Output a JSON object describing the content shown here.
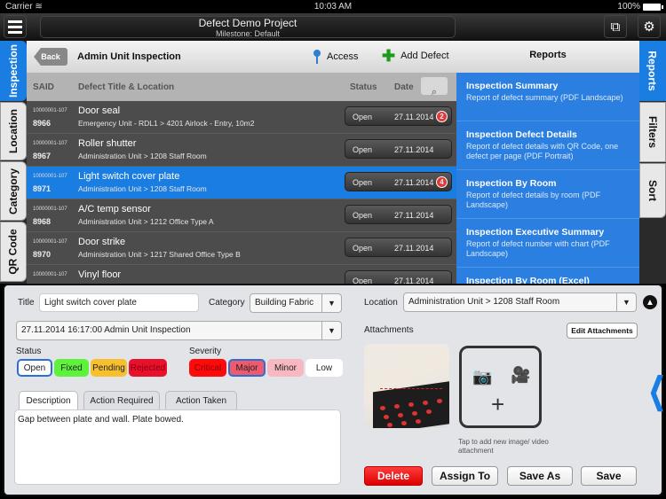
{
  "status_bar": {
    "carrier": "Carrier",
    "wifi_icon": "wifi-icon",
    "time": "10:03 AM",
    "battery": "100%"
  },
  "header": {
    "title": "Defect Demo Project",
    "subtitle": "Milestone: Default",
    "menu_icon": "menu-icon",
    "external_icon": "external-window-icon",
    "settings_icon": "gear-icon"
  },
  "left_tabs": [
    {
      "label": "Inspection",
      "active": true
    },
    {
      "label": "Location",
      "active": false
    },
    {
      "label": "Category",
      "active": false
    },
    {
      "label": "QR Code",
      "active": false
    }
  ],
  "toolbar": {
    "back_label": "Back",
    "title": "Admin Unit Inspection",
    "access_label": "Access",
    "add_defect_label": "Add Defect"
  },
  "columns": {
    "said": "SAID",
    "title": "Defect Title & Location",
    "status": "Status",
    "date": "Date"
  },
  "defects": [
    {
      "said_top": "10000001-107",
      "said": "8966",
      "title": "Door seal",
      "location": "Emergency Unit - RDL1 > 4201 Airlock - Entry, 10m2",
      "status": "Open",
      "date": "27.11.2014",
      "badge": "2",
      "selected": false
    },
    {
      "said_top": "10000001-107",
      "said": "8967",
      "title": "Roller shutter",
      "location": "Administration Unit > 1208 Staff Room",
      "status": "Open",
      "date": "27.11.2014",
      "badge": "",
      "selected": false
    },
    {
      "said_top": "10000001-107",
      "said": "8971",
      "title": "Light switch cover plate",
      "location": "Administration Unit > 1208 Staff Room",
      "status": "Open",
      "date": "27.11.2014",
      "badge": "4",
      "selected": true
    },
    {
      "said_top": "10000001-107",
      "said": "8968",
      "title": "A/C temp sensor",
      "location": "Administration Unit > 1212 Office Type A",
      "status": "Open",
      "date": "27.11.2014",
      "badge": "",
      "selected": false
    },
    {
      "said_top": "10000001-107",
      "said": "8970",
      "title": "Door strike",
      "location": "Administration Unit > 1217 Shared Office Type B",
      "status": "Open",
      "date": "27.11.2014",
      "badge": "",
      "selected": false
    },
    {
      "said_top": "10000001-107",
      "said": "",
      "title": "Vinyl floor",
      "location": "",
      "status": "Open",
      "date": "27.11.2014",
      "badge": "",
      "selected": false
    }
  ],
  "reports": {
    "header": "Reports",
    "items": [
      {
        "title": "Inspection Summary",
        "desc": "Report of defect summary (PDF Landscape)"
      },
      {
        "title": "Inspection Defect Details",
        "desc": "Report of defect details with QR Code, one defect per page (PDF Portrait)"
      },
      {
        "title": "Inspection By Room",
        "desc": "Report of defect details by room (PDF Landscape)"
      },
      {
        "title": "Inspection Executive Summary",
        "desc": "Report of defect number with chart (PDF Landscape)"
      },
      {
        "title": "Inspection By Room (Excel)",
        "desc": ""
      }
    ]
  },
  "right_tabs": [
    {
      "label": "Reports",
      "active": true
    },
    {
      "label": "Filters",
      "active": false
    },
    {
      "label": "Sort",
      "active": false
    }
  ],
  "detail": {
    "title_label": "Title",
    "title_value": "Light switch cover plate",
    "category_label": "Category",
    "category_value": "Building Fabric",
    "inspection_value": "27.11.2014 16:17:00 Admin Unit Inspection",
    "location_label": "Location",
    "location_value": "Administration Unit > 1208 Staff Room",
    "status_label": "Status",
    "status_options": [
      {
        "label": "Open",
        "color": "#ffffff",
        "selected": true
      },
      {
        "label": "Fixed",
        "color": "#5ef23a",
        "selected": false
      },
      {
        "label": "Pending",
        "color": "#f7c02e",
        "selected": false
      },
      {
        "label": "Rejected",
        "color": "#e8102a",
        "selected": false
      }
    ],
    "severity_label": "Severity",
    "severity_options": [
      {
        "label": "Critical",
        "color": "#ff0a0a",
        "selected": false
      },
      {
        "label": "Major",
        "color": "#f05a6e",
        "selected": true
      },
      {
        "label": "Minor",
        "color": "#f7b8c2",
        "selected": false
      },
      {
        "label": "Low",
        "color": "#ffffff",
        "selected": false
      }
    ],
    "tabs": [
      "Description",
      "Action Required",
      "Action Taken"
    ],
    "active_tab": "Description",
    "description": "Gap between plate and wall. Plate bowed.",
    "attachments_label": "Attachments",
    "edit_attachments_label": "Edit Attachments",
    "add_hint": "Tap to add new image/ video attachment",
    "buttons": {
      "delete": "Delete",
      "assign": "Assign To",
      "save_as": "Save As",
      "save": "Save"
    }
  },
  "colors": {
    "accent": "#1a7de2",
    "delete": "#e8102a",
    "add_green": "#1c9a1c"
  }
}
